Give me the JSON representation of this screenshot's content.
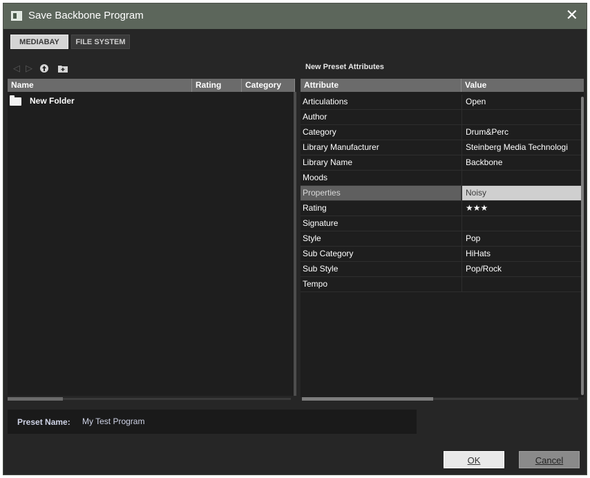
{
  "window": {
    "title": "Save Backbone Program",
    "close_icon": "close-icon"
  },
  "tabs": [
    {
      "label": "MEDIABAY",
      "selected": true
    },
    {
      "label": "FILE SYSTEM",
      "selected": false
    }
  ],
  "toolbar": {
    "icons": [
      "back-icon",
      "forward-icon",
      "up-folder-icon",
      "new-folder-icon"
    ]
  },
  "file_browser": {
    "columns": [
      "Name",
      "Rating",
      "Category"
    ],
    "items": [
      {
        "name": "New Folder",
        "icon": "folder-icon"
      }
    ]
  },
  "attributes_panel": {
    "title": "New Preset Attributes",
    "columns": [
      "Attribute",
      "Value"
    ],
    "rows": [
      {
        "attribute": "Articulations",
        "value": "Open"
      },
      {
        "attribute": "Author",
        "value": ""
      },
      {
        "attribute": "Category",
        "value": "Drum&Perc"
      },
      {
        "attribute": "Library Manufacturer",
        "value": "Steinberg Media Technologi"
      },
      {
        "attribute": "Library Name",
        "value": "Backbone"
      },
      {
        "attribute": "Moods",
        "value": ""
      },
      {
        "attribute": "Properties",
        "value": "Noisy",
        "selected": true
      },
      {
        "attribute": "Rating",
        "value": "★★★"
      },
      {
        "attribute": "Signature",
        "value": ""
      },
      {
        "attribute": "Style",
        "value": "Pop"
      },
      {
        "attribute": "Sub Category",
        "value": "HiHats"
      },
      {
        "attribute": "Sub Style",
        "value": "Pop/Rock"
      },
      {
        "attribute": "Tempo",
        "value": ""
      }
    ]
  },
  "preset": {
    "label": "Preset Name:",
    "value": "My Test Program"
  },
  "buttons": {
    "ok": "OK",
    "cancel": "Cancel"
  },
  "colors": {
    "titlebar": "#5c665b",
    "background": "#262626",
    "header": "#6b6b6b",
    "selected_value": "#cfcfcf"
  }
}
